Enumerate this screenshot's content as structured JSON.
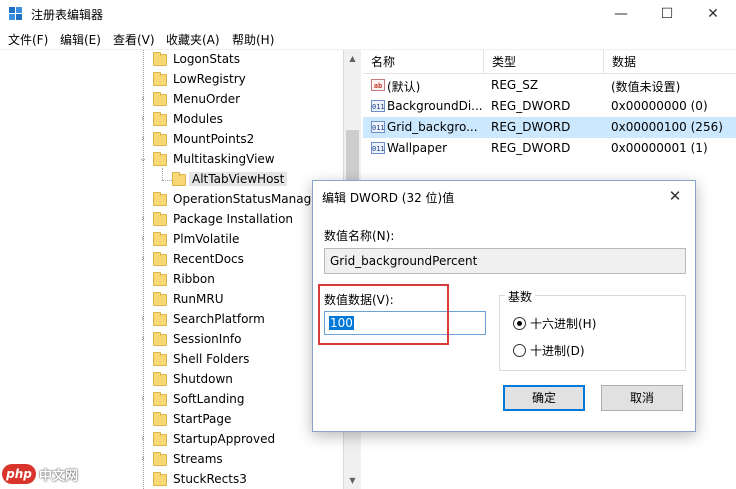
{
  "window": {
    "title": "注册表编辑器",
    "minimize_glyph": "—",
    "maximize_glyph": "☐",
    "close_glyph": "✕"
  },
  "menu": [
    "文件(F)",
    "编辑(E)",
    "查看(V)",
    "收藏夹(A)",
    "帮助(H)"
  ],
  "tree": {
    "items": [
      {
        "label": "LogonStats",
        "expander": ""
      },
      {
        "label": "LowRegistry",
        "expander": ""
      },
      {
        "label": "MenuOrder",
        "expander": "›"
      },
      {
        "label": "Modules",
        "expander": "›"
      },
      {
        "label": "MountPoints2",
        "expander": "›"
      },
      {
        "label": "MultitaskingView",
        "expander": "⌄"
      },
      {
        "label": "AltTabViewHost",
        "expander": "",
        "child": true,
        "selected": true
      },
      {
        "label": "OperationStatusManag",
        "expander": ""
      },
      {
        "label": "Package Installation",
        "expander": "›"
      },
      {
        "label": "PlmVolatile",
        "expander": "›"
      },
      {
        "label": "RecentDocs",
        "expander": "›"
      },
      {
        "label": "Ribbon",
        "expander": ""
      },
      {
        "label": "RunMRU",
        "expander": ""
      },
      {
        "label": "SearchPlatform",
        "expander": "›"
      },
      {
        "label": "SessionInfo",
        "expander": "›"
      },
      {
        "label": "Shell Folders",
        "expander": ""
      },
      {
        "label": "Shutdown",
        "expander": ""
      },
      {
        "label": "SoftLanding",
        "expander": "›"
      },
      {
        "label": "StartPage",
        "expander": ""
      },
      {
        "label": "StartupApproved",
        "expander": "›"
      },
      {
        "label": "Streams",
        "expander": "›"
      },
      {
        "label": "StuckRects3",
        "expander": ""
      }
    ]
  },
  "scrollbar": {
    "up": "▲",
    "down": "▼"
  },
  "list": {
    "columns": [
      "名称",
      "类型",
      "数据"
    ],
    "rows": [
      {
        "icon": "ab",
        "icon_name": "string-value-icon",
        "name": "(默认)",
        "type": "REG_SZ",
        "data": "(数值未设置)",
        "selected": false
      },
      {
        "icon": "011",
        "icon_name": "dword-value-icon",
        "name": "BackgroundDi...",
        "type": "REG_DWORD",
        "data": "0x00000000 (0)",
        "selected": false
      },
      {
        "icon": "011",
        "icon_name": "dword-value-icon",
        "name": "Grid_backgro...",
        "type": "REG_DWORD",
        "data": "0x00000100 (256)",
        "selected": true
      },
      {
        "icon": "011",
        "icon_name": "dword-value-icon",
        "name": "Wallpaper",
        "type": "REG_DWORD",
        "data": "0x00000001 (1)",
        "selected": false
      }
    ]
  },
  "dialog": {
    "title": "编辑 DWORD (32 位)值",
    "close_glyph": "✕",
    "name_label": "数值名称(N):",
    "name_value": "Grid_backgroundPercent",
    "data_label": "数值数据(V):",
    "data_value": "100",
    "base_label": "基数",
    "radio_hex": "十六进制(H)",
    "radio_dec": "十进制(D)",
    "hex_checked": true,
    "ok_label": "确定",
    "cancel_label": "取消"
  },
  "watermark": {
    "logo": "php",
    "text": "中文网"
  },
  "colors": {
    "selection": "#cce8ff",
    "highlight_box": "#d93b3b",
    "text_selection": "#0078d7",
    "folder": "#f8d775"
  }
}
